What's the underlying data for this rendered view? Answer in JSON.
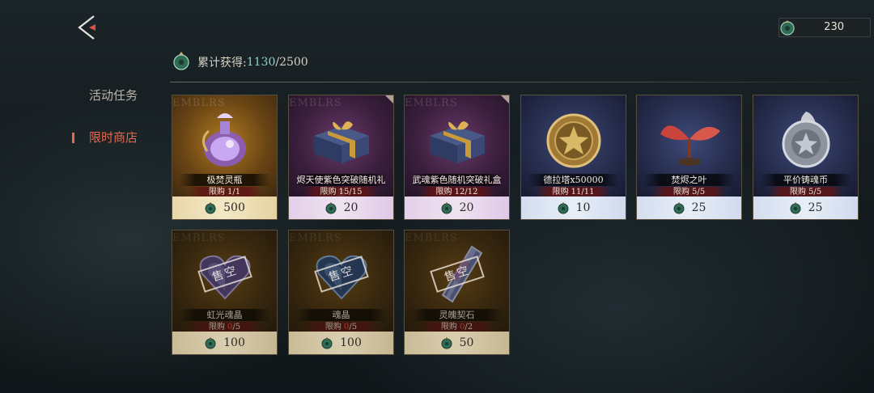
{
  "header": {
    "back_label": "",
    "currency": {
      "icon": "jade-coin-icon",
      "amount": "230"
    }
  },
  "sidebar": {
    "items": [
      {
        "label": "活动任务",
        "active": false
      },
      {
        "label": "限时商店",
        "active": true
      }
    ]
  },
  "progress": {
    "label": "累计获得:",
    "current": "1130",
    "separator": "/",
    "total": "2500"
  },
  "shop": {
    "watermark": "EMBLRS",
    "sold_out_label": "售空",
    "limit_prefix": "限购",
    "items": [
      {
        "name": "极焚灵瓶",
        "limit_bought": "1",
        "limit_total": "1",
        "price": "500",
        "icon": "spirit-vial-icon"
      },
      {
        "name": "烬天使紫色突破随机礼盒",
        "limit_bought": "15",
        "limit_total": "15",
        "price": "20",
        "icon": "gift-box-icon"
      },
      {
        "name": "武魂紫色随机突破礼盒",
        "limit_bought": "12",
        "limit_total": "12",
        "price": "20",
        "icon": "gift-box-icon"
      },
      {
        "name": "德拉塔x50000",
        "limit_bought": "11",
        "limit_total": "11",
        "price": "10",
        "icon": "gold-coin-icon"
      },
      {
        "name": "焚烬之叶",
        "limit_bought": "5",
        "limit_total": "5",
        "price": "25",
        "icon": "sprout-leaf-icon"
      },
      {
        "name": "平价铸魂币",
        "limit_bought": "5",
        "limit_total": "5",
        "price": "25",
        "icon": "silver-coin-icon"
      },
      {
        "name": "虹光魂晶",
        "limit_bought": "0",
        "limit_total": "5",
        "price": "100",
        "icon": "heart-crystal-icon",
        "sold_out": true
      },
      {
        "name": "魂晶",
        "limit_bought": "0",
        "limit_total": "5",
        "price": "100",
        "icon": "heart-crystal-icon",
        "sold_out": true
      },
      {
        "name": "灵魄契石",
        "limit_bought": "0",
        "limit_total": "2",
        "price": "50",
        "icon": "crystal-shard-icon",
        "sold_out": true
      }
    ]
  },
  "colors": {
    "accent": "#e8674e",
    "progress_current": "#8fd3cc"
  }
}
